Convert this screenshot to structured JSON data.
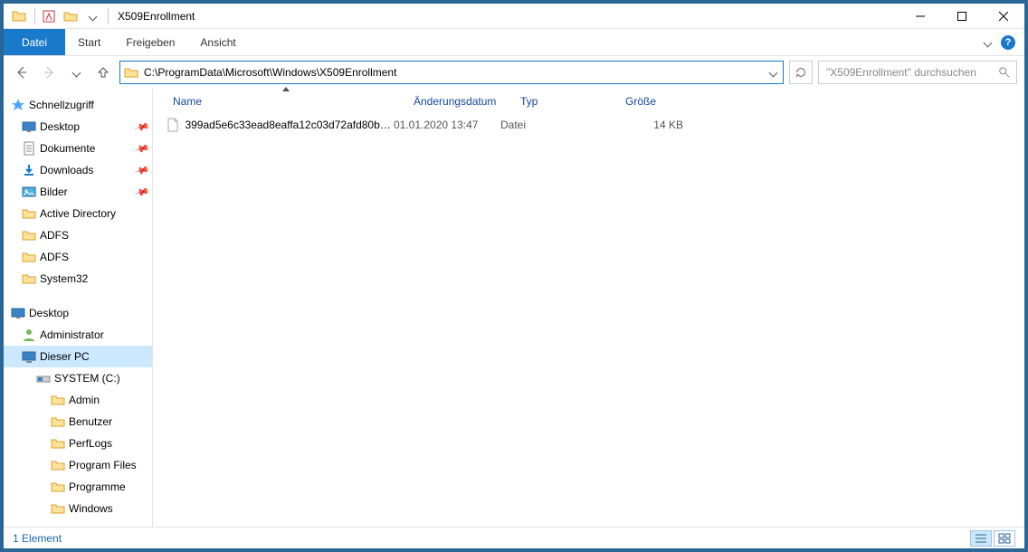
{
  "window": {
    "title": "X509Enrollment"
  },
  "ribbon": {
    "tabs": {
      "file": "Datei",
      "home": "Start",
      "share": "Freigeben",
      "view": "Ansicht"
    }
  },
  "nav": {
    "address": "C:\\ProgramData\\Microsoft\\Windows\\X509Enrollment",
    "search_placeholder": "\"X509Enrollment\" durchsuchen"
  },
  "tree": {
    "quick_access": "Schnellzugriff",
    "desktop": "Desktop",
    "documents": "Dokumente",
    "downloads": "Downloads",
    "pictures": "Bilder",
    "active_directory": "Active Directory",
    "adfs1": "ADFS",
    "adfs2": "ADFS",
    "system32": "System32",
    "desktop2": "Desktop",
    "administrator": "Administrator",
    "this_pc": "Dieser PC",
    "system_c": "SYSTEM (C:)",
    "admin": "Admin",
    "users": "Benutzer",
    "perflogs": "PerfLogs",
    "program_files": "Program Files",
    "programme": "Programme",
    "windows": "Windows"
  },
  "columns": {
    "name": "Name",
    "modified": "Änderungsdatum",
    "type": "Typ",
    "size": "Größe"
  },
  "files": [
    {
      "name": "399ad5e6c33ead8eaffa12c03d72afd80be9...",
      "modified": "01.01.2020 13:47",
      "type": "Datei",
      "size": "14 KB"
    }
  ],
  "status": {
    "count": "1 Element"
  }
}
